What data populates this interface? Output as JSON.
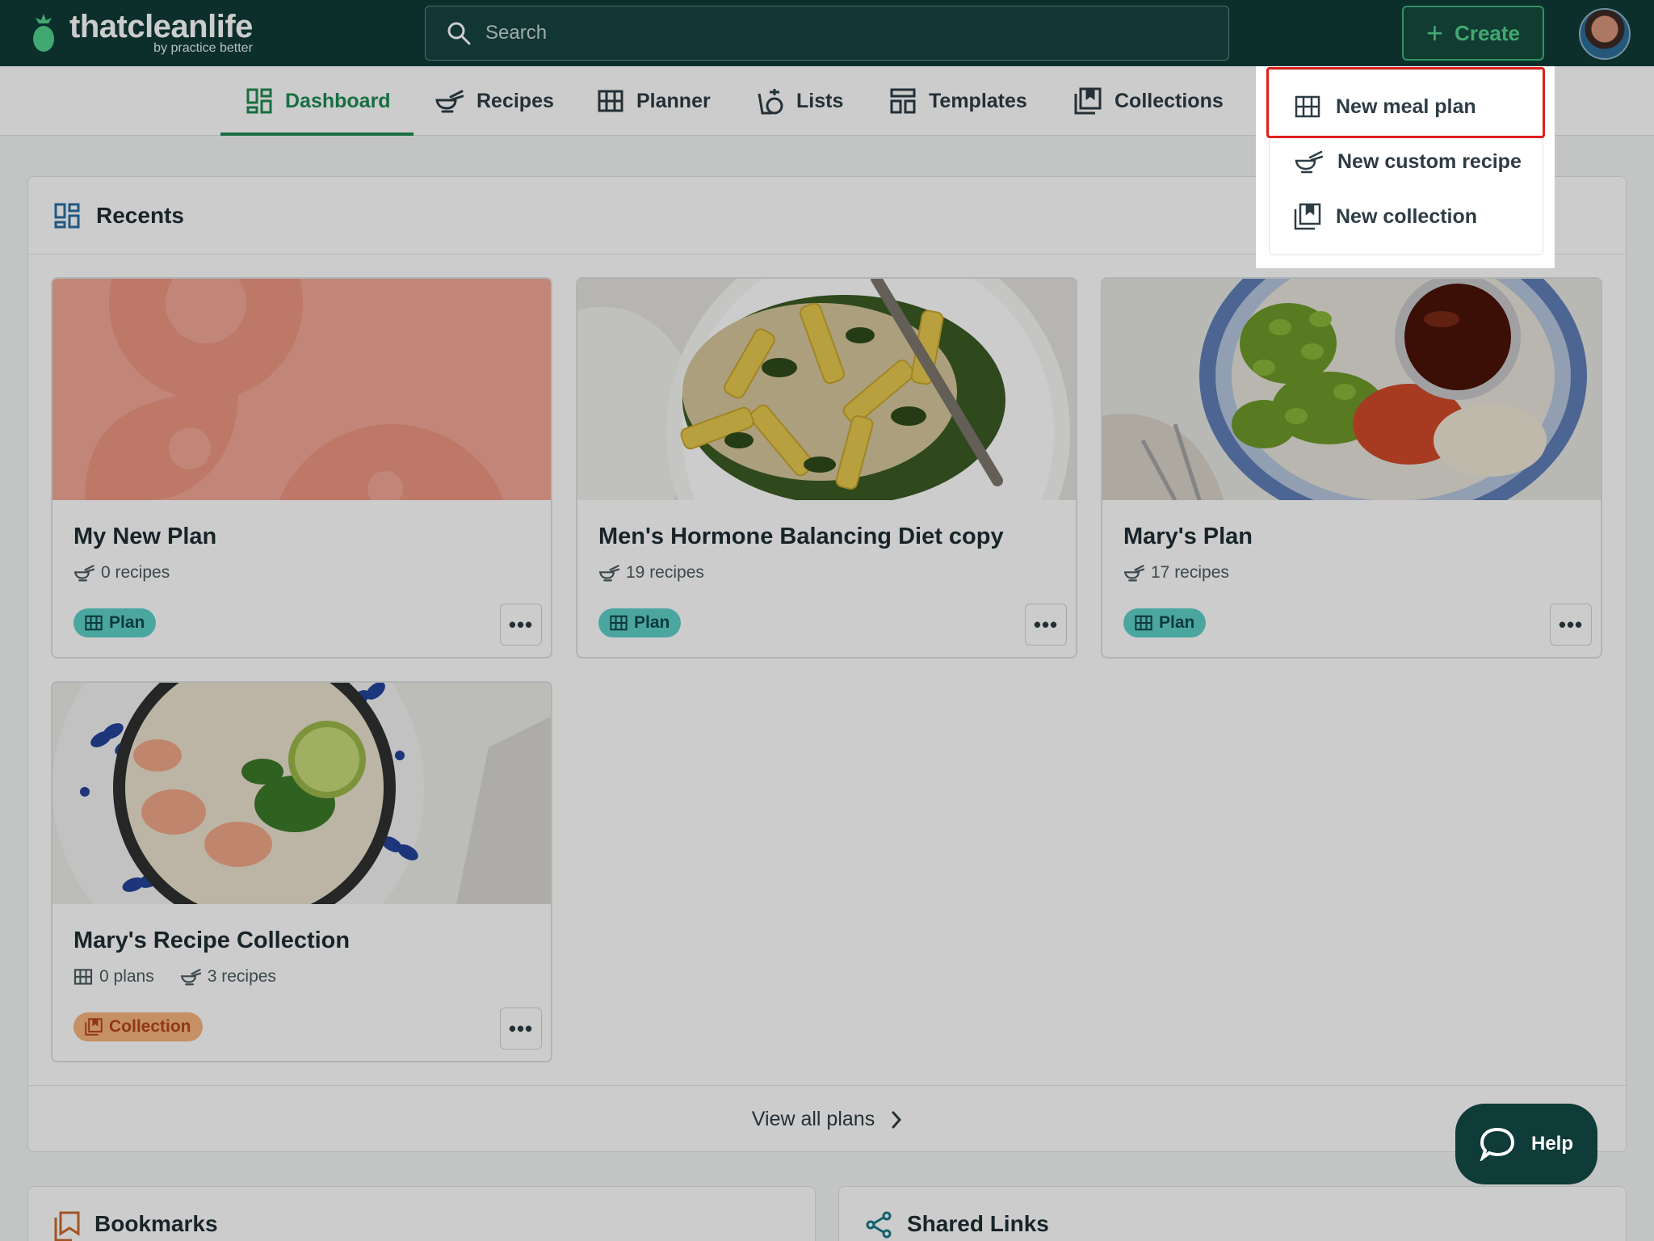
{
  "brand": {
    "name": "thatcleanlife",
    "tagline": "by practice better"
  },
  "search": {
    "placeholder": "Search"
  },
  "header": {
    "create_label": "Create"
  },
  "nav": {
    "items": [
      {
        "label": "Dashboard",
        "active": true
      },
      {
        "label": "Recipes"
      },
      {
        "label": "Planner"
      },
      {
        "label": "Lists"
      },
      {
        "label": "Templates"
      },
      {
        "label": "Collections"
      }
    ]
  },
  "create_menu": {
    "items": [
      {
        "label": "New meal plan",
        "icon": "grid-icon"
      },
      {
        "label": "New custom recipe",
        "icon": "recipe-icon"
      },
      {
        "label": "New collection",
        "icon": "collection-icon"
      }
    ]
  },
  "recents": {
    "title": "Recents",
    "cards": [
      {
        "title": "My New Plan",
        "recipes": "0 recipes",
        "badge": "Plan"
      },
      {
        "title": "Men's Hormone Balancing Diet copy",
        "recipes": "19 recipes",
        "badge": "Plan"
      },
      {
        "title": "Mary's Plan",
        "recipes": "17 recipes",
        "badge": "Plan"
      },
      {
        "title": "Mary's Recipe Collection",
        "plans": "0 plans",
        "recipes": "3 recipes",
        "badge": "Collection"
      }
    ],
    "view_all_label": "View all plans"
  },
  "panels": {
    "bookmarks_title": "Bookmarks",
    "shared_links_title": "Shared Links"
  },
  "help": {
    "label": "Help"
  },
  "colors": {
    "brand_dark": "#0f3b38",
    "accent_green": "#1e8a51",
    "plan_badge": "#5fd0c8",
    "collection_badge": "#f7b57c",
    "highlight": "#e0201c"
  }
}
